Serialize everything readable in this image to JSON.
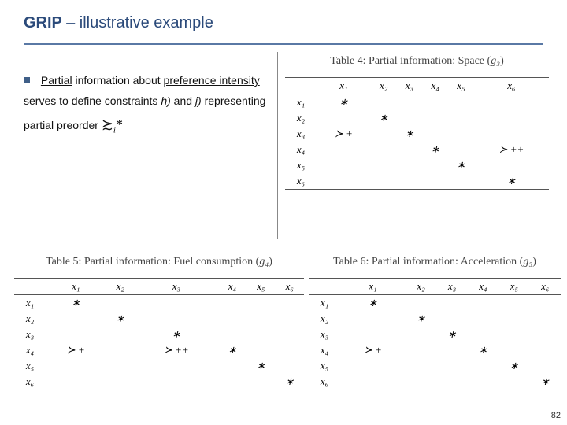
{
  "title": {
    "strong": "GRIP",
    "light": " – illustrative example"
  },
  "body": {
    "s1": "Partial",
    "s2": " information about ",
    "s3": "preference intensity",
    "s4": " serves to define constraints ",
    "s5": "h)",
    "s6": " and ",
    "s7": "j)",
    "s8": " representing  partial preorder "
  },
  "cols": [
    "x₁",
    "x₂",
    "x₃",
    "x₄",
    "x₅",
    "x₆"
  ],
  "rows": [
    "x₁",
    "x₂",
    "x₃",
    "x₄",
    "x₅",
    "x₆"
  ],
  "tables": [
    {
      "caption_a": "Table 4: Partial information: Space",
      "caption_b": "g₃",
      "c": [
        [
          "∗",
          "",
          "",
          "",
          "",
          ""
        ],
        [
          "",
          "∗",
          "",
          "",
          "",
          ""
        ],
        [
          "≻ +",
          "",
          "∗",
          "",
          "",
          ""
        ],
        [
          "",
          "",
          "",
          "∗",
          "",
          "≻ ++"
        ],
        [
          "",
          "",
          "",
          "",
          "∗",
          ""
        ],
        [
          "",
          "",
          "",
          "",
          "",
          "∗"
        ]
      ]
    },
    {
      "caption_a": "Table 5: Partial information: Fuel consumption",
      "caption_b": "g₄",
      "c": [
        [
          "∗",
          "",
          "",
          "",
          "",
          ""
        ],
        [
          "",
          "∗",
          "",
          "",
          "",
          ""
        ],
        [
          "",
          "",
          "∗",
          "",
          "",
          ""
        ],
        [
          "≻ +",
          "",
          "≻ ++",
          "∗",
          "",
          ""
        ],
        [
          "",
          "",
          "",
          "",
          "∗",
          ""
        ],
        [
          "",
          "",
          "",
          "",
          "",
          "∗"
        ]
      ]
    },
    {
      "caption_a": "Table 6: Partial information: Acceleration",
      "caption_b": "g₅",
      "c": [
        [
          "∗",
          "",
          "",
          "",
          "",
          ""
        ],
        [
          "",
          "∗",
          "",
          "",
          "",
          ""
        ],
        [
          "",
          "",
          "∗",
          "",
          "",
          ""
        ],
        [
          "≻ +",
          "",
          "",
          "∗",
          "",
          ""
        ],
        [
          "",
          "",
          "",
          "",
          "∗",
          ""
        ],
        [
          "",
          "",
          "",
          "",
          "",
          "∗"
        ]
      ]
    }
  ],
  "page_number": "82"
}
